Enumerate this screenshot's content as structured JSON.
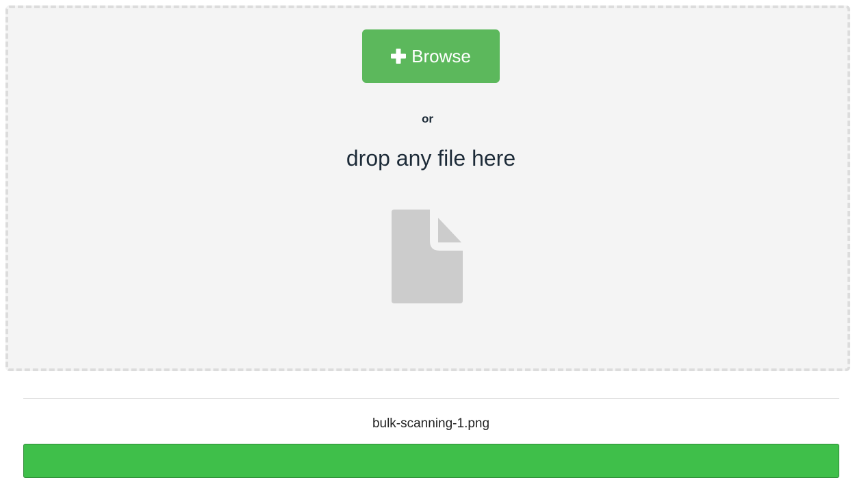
{
  "dropzone": {
    "browse_label": "Browse",
    "browse_icon": "plus-icon",
    "or_text": "or",
    "drop_text": "drop any file here",
    "file_icon": "file-icon"
  },
  "upload": {
    "file_name": "bulk-scanning-1.png",
    "progress_percent": 100,
    "progress_color": "#3fbf4a"
  },
  "colors": {
    "accent": "#5cb85c",
    "dropzone_background": "#f4f4f4",
    "text": "#1d2b38"
  }
}
